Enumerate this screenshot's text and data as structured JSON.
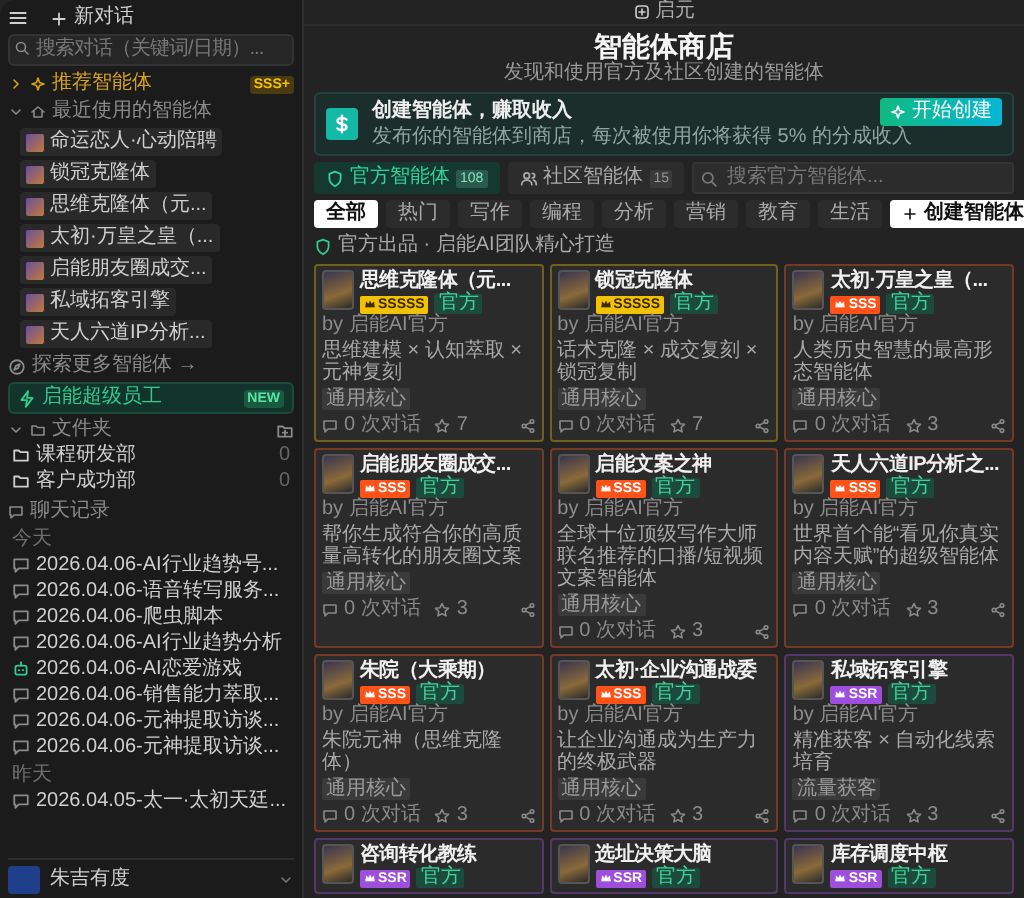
{
  "sidebar": {
    "new_chat": "新对话",
    "search": {
      "placeholder": "搜索对话（关键词/日期）..."
    },
    "recommended": {
      "label": "推荐智能体",
      "badge": "SSS+",
      "expanded": false
    },
    "recent": {
      "label": "最近使用的智能体",
      "expanded": true,
      "items": [
        {
          "name": "命运恋人·心动陪聘"
        },
        {
          "name": "锁冠克隆体"
        },
        {
          "name": "思维克隆体（元..."
        },
        {
          "name": "太初·万皇之皇（..."
        },
        {
          "name": "启能朋友圈成交..."
        },
        {
          "name": "私域拓客引擎"
        },
        {
          "name": "天人六道IP分析..."
        }
      ]
    },
    "explore": "探索更多智能体 →",
    "super_employee": {
      "label": "启能超级员工",
      "badge": "NEW"
    },
    "folders": {
      "label": "文件夹",
      "expanded": true,
      "items": [
        {
          "name": "课程研发部",
          "count": "0"
        },
        {
          "name": "客户成功部",
          "count": "0"
        }
      ]
    },
    "history": {
      "label": "聊天记录",
      "groups": [
        {
          "label": "今天",
          "items": [
            {
              "title": "2026.04.06-AI行业趋势号...",
              "kind": "chat"
            },
            {
              "title": "2026.04.06-语音转写服务...",
              "kind": "chat"
            },
            {
              "title": "2026.04.06-爬虫脚本",
              "kind": "chat"
            },
            {
              "title": "2026.04.06-AI行业趋势分析",
              "kind": "chat"
            },
            {
              "title": "2026.04.06-AI恋爱游戏",
              "kind": "agent"
            },
            {
              "title": "2026.04.06-销售能力萃取...",
              "kind": "chat"
            },
            {
              "title": "2026.04.06-元神提取访谈...",
              "kind": "chat"
            },
            {
              "title": "2026.04.06-元神提取访谈...",
              "kind": "chat"
            }
          ]
        },
        {
          "label": "昨天",
          "items": [
            {
              "title": "2026.04.05-太一·太初天廷...",
              "kind": "chat"
            }
          ]
        }
      ]
    },
    "user": {
      "name": "朱吉有度"
    }
  },
  "main": {
    "title": "启元",
    "heading": "智能体商店",
    "subheading": "发现和使用官方及社区创建的智能体",
    "banner": {
      "title": "创建智能体，赚取收入",
      "text": "发布你的智能体到商店，每次被使用你将获得 5% 的分成收入",
      "button": "开始创建"
    },
    "tabs": [
      {
        "label": "官方智能体",
        "count": "108",
        "selected": true
      },
      {
        "label": "社区智能体",
        "count": "15",
        "selected": false
      }
    ],
    "search": {
      "placeholder": "搜索官方智能体..."
    },
    "create_button": "创建智能体",
    "categories": [
      {
        "label": "全部",
        "selected": true
      },
      {
        "label": "热门",
        "selected": false
      },
      {
        "label": "写作",
        "selected": false
      },
      {
        "label": "编程",
        "selected": false
      },
      {
        "label": "分析",
        "selected": false
      },
      {
        "label": "营销",
        "selected": false
      },
      {
        "label": "教育",
        "selected": false
      },
      {
        "label": "生活",
        "selected": false
      }
    ],
    "section_title": "官方出品 · 启能AI团队精心打造",
    "cards": [
      {
        "name": "思维克隆体（元...",
        "color": "#f2c200",
        "rarity": "SSSSS",
        "official": "官方",
        "author": "by 启能AI官方",
        "description": "思维建模 × 认知萃取 × 元神复刻",
        "tag": "通用核心",
        "chats": "0 次对话",
        "favorites": "7"
      },
      {
        "name": "锁冠克隆体",
        "color": "#f2c200",
        "rarity": "SSSSS",
        "official": "官方",
        "author": "by 启能AI官方",
        "description": "话术克隆 × 成交复刻 × 锁冠复制",
        "tag": "通用核心",
        "chats": "0 次对话",
        "favorites": "7"
      },
      {
        "name": "太初·万皇之皇（...",
        "color": "#ff5219",
        "rarity": "SSS",
        "official": "官方",
        "author": "by 启能AI官方",
        "description": "人类历史智慧的最高形态智能体",
        "tag": "通用核心",
        "chats": "0 次对话",
        "favorites": "3"
      },
      {
        "name": "启能朋友圈成交...",
        "color": "#ff5219",
        "rarity": "SSS",
        "official": "官方",
        "author": "by 启能AI官方",
        "description": "帮你生成符合你的高质量高转化的朋友圈文案",
        "tag": "通用核心",
        "chats": "0 次对话",
        "favorites": "3"
      },
      {
        "name": "启能文案之神",
        "color": "#ff5219",
        "rarity": "SSS",
        "official": "官方",
        "author": "by 启能AI官方",
        "description": "全球十位顶级写作大师联名推荐的口播/短视频文案智能体",
        "tag": "通用核心",
        "chats": "0 次对话",
        "favorites": "3"
      },
      {
        "name": "天人六道IP分析之...",
        "color": "#ff5219",
        "rarity": "SSS",
        "official": "官方",
        "author": "by 启能AI官方",
        "description": "世界首个能“看见你真实内容天赋”的超级智能体",
        "tag": "通用核心",
        "chats": "0 次对话",
        "favorites": "3"
      },
      {
        "name": "朱院（大乘期）",
        "color": "#ff5219",
        "rarity": "SSS",
        "official": "官方",
        "author": "by 启能AI官方",
        "description": "朱院元神（思维克隆体）",
        "tag": "通用核心",
        "chats": "0 次对话",
        "favorites": "3"
      },
      {
        "name": "太初·企业沟通战委",
        "color": "#ff5219",
        "rarity": "SSS",
        "official": "官方",
        "author": "by 启能AI官方",
        "description": "让企业沟通成为生产力的终极武器",
        "tag": "通用核心",
        "chats": "0 次对话",
        "favorites": "3"
      },
      {
        "name": "私域拓客引擎",
        "color": "#9d4edd",
        "rarity": "SSR",
        "official": "官方",
        "author": "by 启能AI官方",
        "description": "精准获客 × 自动化线索培育",
        "tag": "流量获客",
        "chats": "0 次对话",
        "favorites": "3"
      },
      {
        "name": "咨询转化教练",
        "color": "#9d4edd",
        "rarity": "SSR",
        "official": "官方"
      },
      {
        "name": "选址决策大脑",
        "color": "#9d4edd",
        "rarity": "SSR",
        "official": "官方"
      },
      {
        "name": "库存调度中枢",
        "color": "#9d4edd",
        "rarity": "SSR",
        "official": "官方"
      }
    ]
  }
}
